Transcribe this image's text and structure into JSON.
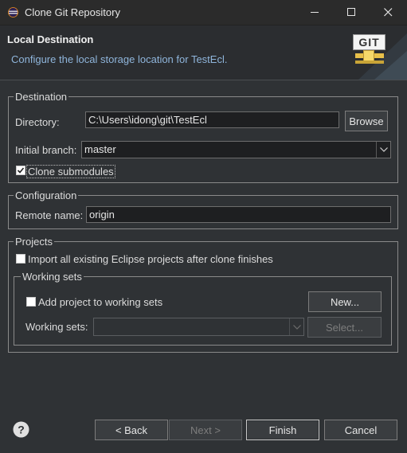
{
  "window": {
    "title": "Clone Git Repository",
    "controls": [
      "minimize-icon",
      "maximize-icon",
      "close-icon"
    ]
  },
  "header": {
    "title": "Local Destination",
    "description": "Configure the local storage location for TestEcl.",
    "logo_text": "GIT",
    "colors": {
      "description": "#8fb5db"
    }
  },
  "destination": {
    "group_label": "Destination",
    "directory_label": "Directory:",
    "directory_value": "C:\\Users\\idong\\git\\TestEcl",
    "browse_label": "Browse",
    "branch_label": "Initial branch:",
    "branch_value": "master",
    "clone_submodules_label": "Clone submodules",
    "clone_submodules_checked": true
  },
  "configuration": {
    "group_label": "Configuration",
    "remote_name_label": "Remote name:",
    "remote_name_value": "origin"
  },
  "projects": {
    "group_label": "Projects",
    "import_label": "Import all existing Eclipse projects after clone finishes",
    "import_checked": false,
    "working_sets": {
      "group_label": "Working sets",
      "add_label": "Add project to working sets",
      "add_checked": false,
      "new_label": "New...",
      "sets_label": "Working sets:",
      "sets_value": "",
      "select_label": "Select..."
    }
  },
  "footer": {
    "help_icon": "help-icon",
    "back_label": "< Back",
    "next_label": "Next >",
    "finish_label": "Finish",
    "cancel_label": "Cancel"
  }
}
